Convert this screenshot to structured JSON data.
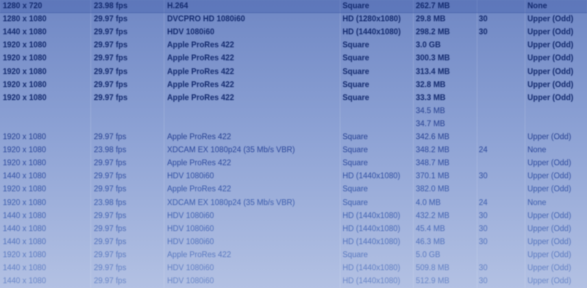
{
  "clip_table": {
    "rows": [
      {
        "cells": [
          "1280 x 720",
          "23.98 fps",
          "H.264",
          "Square",
          "262.7 MB",
          "",
          "None"
        ],
        "bold": true,
        "color": "#132a6e"
      },
      {
        "cells": [
          "1280 x 1080",
          "29.97 fps",
          "DVCPRO HD 1080i60",
          "HD (1280x1080)",
          "29.8 MB",
          "30",
          "Upper (Odd)"
        ],
        "bold": true,
        "color": "#132a6e"
      },
      {
        "cells": [
          "1440 x 1080",
          "29.97 fps",
          "HDV 1080i60",
          "HD (1440x1080)",
          "298.2 MB",
          "30",
          "Upper (Odd)"
        ],
        "bold": true,
        "color": "#132a6e"
      },
      {
        "cells": [
          "1920 x 1080",
          "29.97 fps",
          "Apple ProRes 422",
          "Square",
          "3.0 GB",
          "",
          "Upper (Odd)"
        ],
        "bold": true,
        "color": "#132a6e"
      },
      {
        "cells": [
          "1920 x 1080",
          "29.97 fps",
          "Apple ProRes 422",
          "Square",
          "300.3 MB",
          "",
          "Upper (Odd)"
        ],
        "bold": true,
        "color": "#132a6e"
      },
      {
        "cells": [
          "1920 x 1080",
          "29.97 fps",
          "Apple ProRes 422",
          "Square",
          "313.4 MB",
          "",
          "Upper (Odd)"
        ],
        "bold": true,
        "color": "#132a6e"
      },
      {
        "cells": [
          "1920 x 1080",
          "29.97 fps",
          "Apple ProRes 422",
          "Square",
          "32.8 MB",
          "",
          "Upper (Odd)"
        ],
        "bold": true,
        "color": "#132a6e"
      },
      {
        "cells": [
          "1920 x 1080",
          "29.97 fps",
          "Apple ProRes 422",
          "Square",
          "33.3 MB",
          "",
          "Upper (Odd)"
        ],
        "bold": true,
        "color": "#132a6e"
      },
      {
        "cells": [
          "",
          "",
          "",
          "",
          "34.5 MB",
          "",
          ""
        ],
        "bold": false,
        "color": "#243f90"
      },
      {
        "cells": [
          "",
          "",
          "",
          "",
          "34.7 MB",
          "",
          ""
        ],
        "bold": false,
        "color": "#243f90"
      },
      {
        "cells": [
          "1920 x 1080",
          "29.97 fps",
          "Apple ProRes 422",
          "Square",
          "342.6 MB",
          "",
          "Upper (Odd)"
        ],
        "bold": false,
        "color": "#243f90"
      },
      {
        "cells": [
          "1920 x 1080",
          "23.98 fps",
          "XDCAM EX 1080p24 (35 Mb/s VBR)",
          "Square",
          "348.2 MB",
          "24",
          "None"
        ],
        "bold": false,
        "color": "#2a469a"
      },
      {
        "cells": [
          "1920 x 1080",
          "29.97 fps",
          "Apple ProRes 422",
          "Square",
          "348.7 MB",
          "",
          "Upper (Odd)"
        ],
        "bold": false,
        "color": "#2d4a9e"
      },
      {
        "cells": [
          "1440 x 1080",
          "29.97 fps",
          "HDV 1080i60",
          "HD (1440x1080)",
          "370.1 MB",
          "30",
          "Upper (Odd)"
        ],
        "bold": false,
        "color": "#3150a3"
      },
      {
        "cells": [
          "1920 x 1080",
          "29.97 fps",
          "Apple ProRes 422",
          "Square",
          "382.0 MB",
          "",
          "Upper (Odd)"
        ],
        "bold": false,
        "color": "#3656a8"
      },
      {
        "cells": [
          "1920 x 1080",
          "23.98 fps",
          "XDCAM EX 1080p24 (35 Mb/s VBR)",
          "Square",
          "4.0 MB",
          "24",
          "None"
        ],
        "bold": false,
        "color": "#3b5cad"
      },
      {
        "cells": [
          "1440 x 1080",
          "29.97 fps",
          "HDV 1080i60",
          "HD (1440x1080)",
          "432.2 MB",
          "30",
          "Upper (Odd)"
        ],
        "bold": false,
        "color": "#4263b2"
      },
      {
        "cells": [
          "1440 x 1080",
          "29.97 fps",
          "HDV 1080i60",
          "HD (1440x1080)",
          "45.4 MB",
          "30",
          "Upper (Odd)"
        ],
        "bold": false,
        "color": "#4a6ab7"
      },
      {
        "cells": [
          "1440 x 1080",
          "29.97 fps",
          "HDV 1080i60",
          "HD (1440x1080)",
          "46.3 MB",
          "30",
          "Upper (Odd)"
        ],
        "bold": false,
        "color": "#5272bc"
      },
      {
        "cells": [
          "1920 x 1080",
          "29.97 fps",
          "Apple ProRes 422",
          "Square",
          "5.0 GB",
          "",
          "Upper (Odd)"
        ],
        "bold": false,
        "color": "#5a79c0"
      },
      {
        "cells": [
          "1440 x 1080",
          "29.97 fps",
          "HDV 1080i60",
          "HD (1440x1080)",
          "509.8 MB",
          "30",
          "Upper (Odd)"
        ],
        "bold": false,
        "color": "#6280c4"
      },
      {
        "cells": [
          "1440 x 1080",
          "29.97 fps",
          "HDV 1080i60",
          "HD (1440x1080)",
          "512.9 MB",
          "30",
          "Upper (Odd)"
        ],
        "bold": false,
        "color": "#6a87c8"
      }
    ]
  }
}
